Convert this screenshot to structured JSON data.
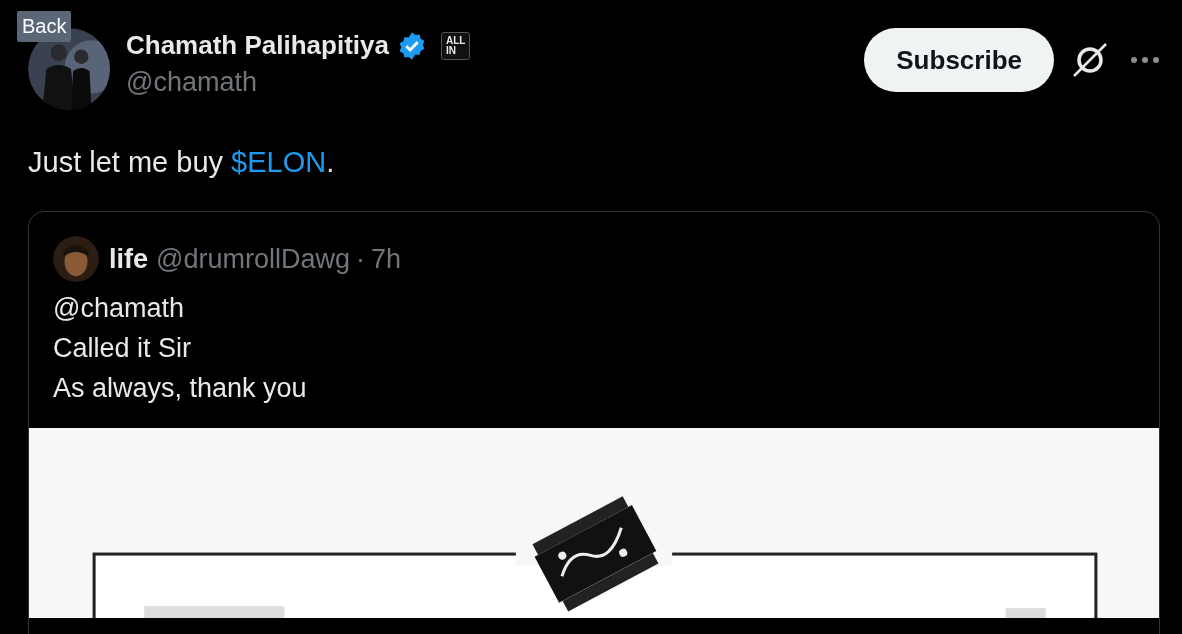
{
  "tooltip": "Back",
  "author": {
    "name": "Chamath Palihapitiya",
    "verified": true,
    "affiliate_badge": [
      "ALL",
      "IN"
    ],
    "handle": "@chamath"
  },
  "subscribe_button": "Subscribe",
  "text": [
    {
      "kind": "plain",
      "text": "Just let me buy "
    },
    {
      "kind": "cashtag",
      "text": "$ELON"
    },
    {
      "kind": "plain",
      "text": "."
    }
  ],
  "quote": {
    "name": "life",
    "handle": "@drumrollDawg",
    "separator": "·",
    "time": "7h",
    "lines": [
      "@chamath",
      "Called it Sir",
      "As always, thank you"
    ]
  }
}
